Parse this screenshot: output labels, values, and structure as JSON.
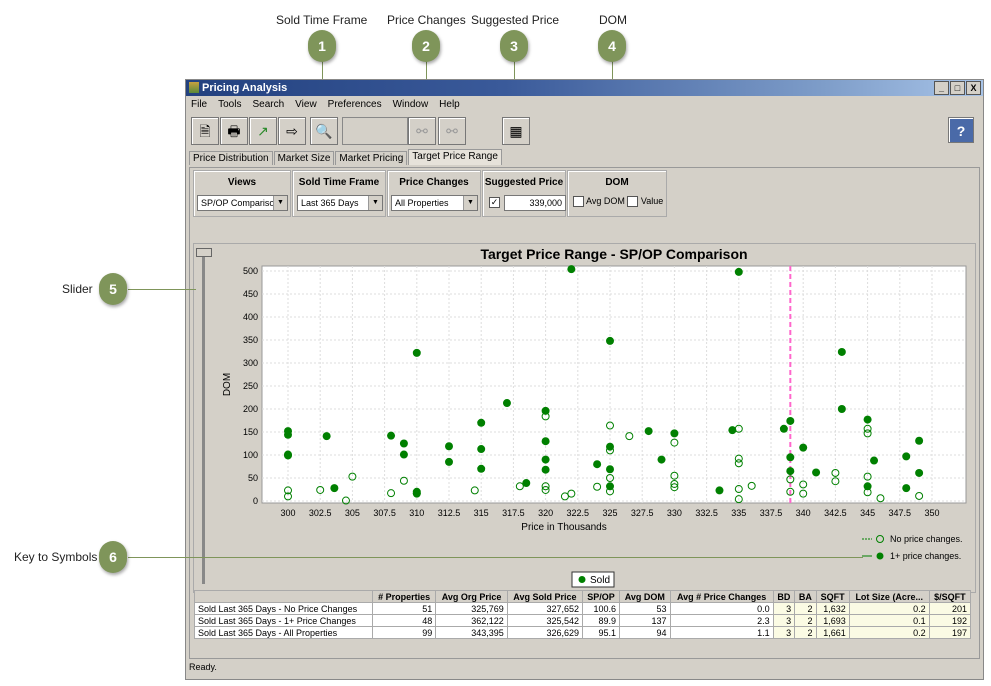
{
  "callouts": [
    {
      "num": "1",
      "label": "Sold Time Frame"
    },
    {
      "num": "2",
      "label": "Price Changes"
    },
    {
      "num": "3",
      "label": "Suggested Price"
    },
    {
      "num": "4",
      "label": "DOM"
    },
    {
      "num": "5",
      "label": "Slider"
    },
    {
      "num": "6",
      "label": "Key to Symbols"
    }
  ],
  "window": {
    "title": "Pricing Analysis",
    "controls": [
      "_",
      "□",
      "X"
    ]
  },
  "menu": [
    "File",
    "Tools",
    "Search",
    "View",
    "Preferences",
    "Window",
    "Help"
  ],
  "tabs": [
    {
      "label": "Price Distribution"
    },
    {
      "label": "Market Size"
    },
    {
      "label": "Market Pricing"
    },
    {
      "label": "Target Price Range",
      "active": true
    }
  ],
  "controls": {
    "views": {
      "title": "Views",
      "value": "SP/OP Comparison"
    },
    "time_frame": {
      "title": "Sold Time Frame",
      "value": "Last 365 Days"
    },
    "price_changes": {
      "title": "Price Changes",
      "value": "All Properties"
    },
    "suggested_price": {
      "title": "Suggested Price",
      "checked": true,
      "value": "339,000"
    },
    "dom": {
      "title": "DOM",
      "avg_dom": "Avg DOM",
      "value": "Value",
      "avg_dom_checked": false,
      "value_checked": false
    }
  },
  "chart_data": {
    "type": "scatter",
    "title": "Target Price Range - SP/OP Comparison",
    "xlabel": "Price in Thousands",
    "ylabel": "DOM",
    "xlim": [
      296,
      354
    ],
    "ylim": [
      0,
      510
    ],
    "xticks": [
      "300",
      "302.5",
      "305",
      "307.5",
      "310",
      "312.5",
      "315",
      "317.5",
      "320",
      "322.5",
      "325",
      "327.5",
      "330",
      "332.5",
      "335",
      "337.5",
      "340",
      "342.5",
      "345",
      "347.5",
      "350"
    ],
    "yticks": [
      "0",
      "50",
      "100",
      "150",
      "200",
      "250",
      "300",
      "350",
      "400",
      "450",
      "500"
    ],
    "grid": true,
    "reference_line_x": 339,
    "colors": {
      "points": "#008000",
      "reference": "#ff66cc"
    },
    "legend": {
      "placement": "bottom-right",
      "items": [
        "No price changes.",
        "1+ price changes."
      ],
      "sold_label": "Sold"
    },
    "series": [
      {
        "name": "1+ price changes.",
        "marker": "filled",
        "points": [
          [
            300,
            152
          ],
          [
            300,
            144
          ],
          [
            300,
            101
          ],
          [
            300,
            99
          ],
          [
            303,
            141
          ],
          [
            303.6,
            28
          ],
          [
            308,
            142
          ],
          [
            309,
            125
          ],
          [
            309,
            101
          ],
          [
            310,
            322
          ],
          [
            310,
            20
          ],
          [
            310,
            17
          ],
          [
            312.5,
            119
          ],
          [
            312.5,
            85
          ],
          [
            315,
            170
          ],
          [
            315,
            113
          ],
          [
            315,
            70
          ],
          [
            317,
            213
          ],
          [
            318.5,
            39
          ],
          [
            320,
            196
          ],
          [
            320,
            130
          ],
          [
            320,
            90
          ],
          [
            320,
            68
          ],
          [
            322,
            504
          ],
          [
            324,
            80
          ],
          [
            325,
            348
          ],
          [
            325,
            118
          ],
          [
            325,
            69
          ],
          [
            325,
            32
          ],
          [
            328,
            152
          ],
          [
            329,
            90
          ],
          [
            330,
            147
          ],
          [
            333.5,
            23
          ],
          [
            334.5,
            154
          ],
          [
            335,
            498
          ],
          [
            338.5,
            157
          ],
          [
            339,
            174
          ],
          [
            339,
            95
          ],
          [
            339,
            65
          ],
          [
            340,
            116
          ],
          [
            341,
            62
          ],
          [
            343,
            324
          ],
          [
            343,
            200
          ],
          [
            345,
            177
          ],
          [
            345,
            32
          ],
          [
            345.5,
            88
          ],
          [
            348,
            97
          ],
          [
            348,
            28
          ],
          [
            349,
            131
          ],
          [
            349,
            61
          ]
        ]
      },
      {
        "name": "No price changes.",
        "marker": "open",
        "points": [
          [
            300,
            23
          ],
          [
            300,
            10
          ],
          [
            302.5,
            24
          ],
          [
            304.5,
            1
          ],
          [
            305,
            53
          ],
          [
            308,
            17
          ],
          [
            309,
            44
          ],
          [
            310,
            16
          ],
          [
            314.5,
            23
          ],
          [
            318,
            32
          ],
          [
            320,
            184
          ],
          [
            320,
            32
          ],
          [
            320,
            24
          ],
          [
            321.5,
            10
          ],
          [
            322,
            16
          ],
          [
            324,
            31
          ],
          [
            325,
            164
          ],
          [
            325,
            110
          ],
          [
            325,
            50
          ],
          [
            325,
            21
          ],
          [
            326.5,
            141
          ],
          [
            330,
            127
          ],
          [
            330,
            55
          ],
          [
            330,
            37
          ],
          [
            330,
            30
          ],
          [
            335,
            157
          ],
          [
            335,
            92
          ],
          [
            335,
            82
          ],
          [
            335,
            26
          ],
          [
            335,
            4
          ],
          [
            336,
            33
          ],
          [
            339,
            47
          ],
          [
            339,
            20
          ],
          [
            340,
            36
          ],
          [
            340,
            16
          ],
          [
            342.5,
            61
          ],
          [
            342.5,
            43
          ],
          [
            345,
            157
          ],
          [
            345,
            147
          ],
          [
            345,
            53
          ],
          [
            345,
            19
          ],
          [
            346,
            6
          ],
          [
            349,
            11
          ]
        ]
      }
    ]
  },
  "table": {
    "headers": [
      "",
      "# Properties",
      "Avg Org Price",
      "Avg Sold Price",
      "SP/OP",
      "Avg DOM",
      "Avg # Price Changes",
      "BD",
      "BA",
      "SQFT",
      "Lot Size (Acre...",
      "$/SQFT"
    ],
    "rows": [
      [
        "Sold Last 365 Days - No Price Changes",
        "51",
        "325,769",
        "327,652",
        "100.6",
        "53",
        "0.0",
        "3",
        "2",
        "1,632",
        "0.2",
        "201"
      ],
      [
        "Sold Last 365 Days - 1+ Price Changes",
        "48",
        "362,122",
        "325,542",
        "89.9",
        "137",
        "2.3",
        "3",
        "2",
        "1,693",
        "0.1",
        "192"
      ],
      [
        "Sold Last 365 Days - All Properties",
        "99",
        "343,395",
        "326,629",
        "95.1",
        "94",
        "1.1",
        "3",
        "2",
        "1,661",
        "0.2",
        "197"
      ]
    ]
  },
  "status": "Ready."
}
